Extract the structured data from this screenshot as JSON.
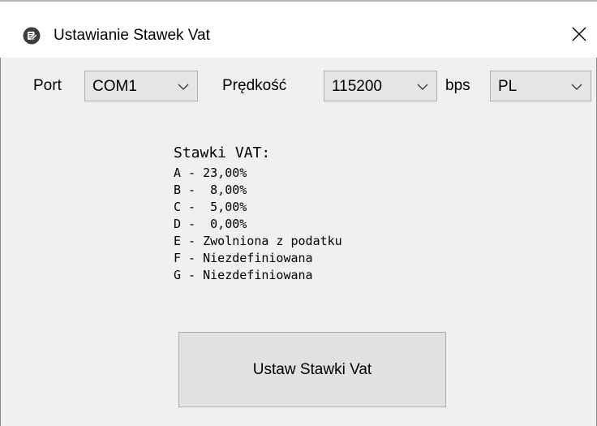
{
  "window": {
    "title": "Ustawianie Stawek Vat",
    "icon": "edit-document-icon",
    "close_icon": "close-icon"
  },
  "settings": {
    "port_label": "Port",
    "port_value": "COM1",
    "speed_label": "Prędkość",
    "speed_value": "115200",
    "speed_unit": "bps",
    "language_value": "PL"
  },
  "vat": {
    "heading": "Stawki VAT:",
    "rates": [
      "A - 23,00%",
      "B -  8,00%",
      "C -  5,00%",
      "D -  0,00%",
      "E - Zwolniona z podatku",
      "F - Niezdefiniowana",
      "G - Niezdefiniowana"
    ]
  },
  "actions": {
    "set_rates_label": "Ustaw Stawki Vat"
  }
}
